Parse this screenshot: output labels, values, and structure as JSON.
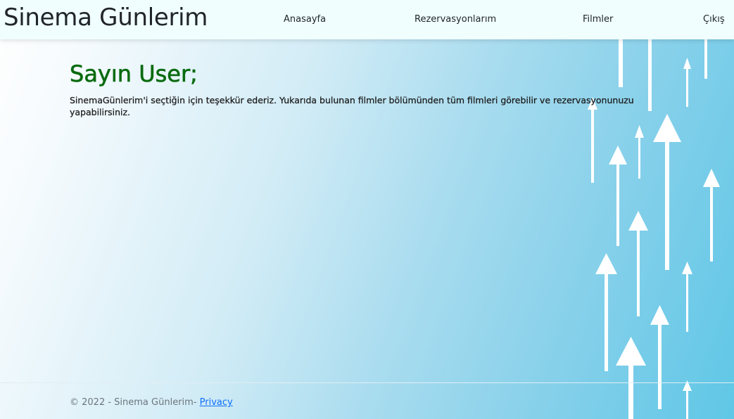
{
  "navbar": {
    "brand": "Sinema Günlerim",
    "links": [
      "Anasayfa",
      "Rezervasyonlarım",
      "Filmler",
      "Çıkış"
    ]
  },
  "main": {
    "greeting": "Sayın User;",
    "message": "SinemaGünlerim'i seçtiğin için teşekkür ederiz. Yukarıda bulunan filmler bölümünden tüm filmleri görebilir ve rezervasyonunuzu yapabilirsiniz."
  },
  "footer": {
    "copyright": "© 2022 - Sinema Günlerim- ",
    "privacy_label": "Privacy"
  },
  "colors": {
    "navbar_bg": "#f0fefe",
    "greeting": "#0a6b10",
    "link": "#0d6efd",
    "background_end": "#5fc7e6"
  }
}
